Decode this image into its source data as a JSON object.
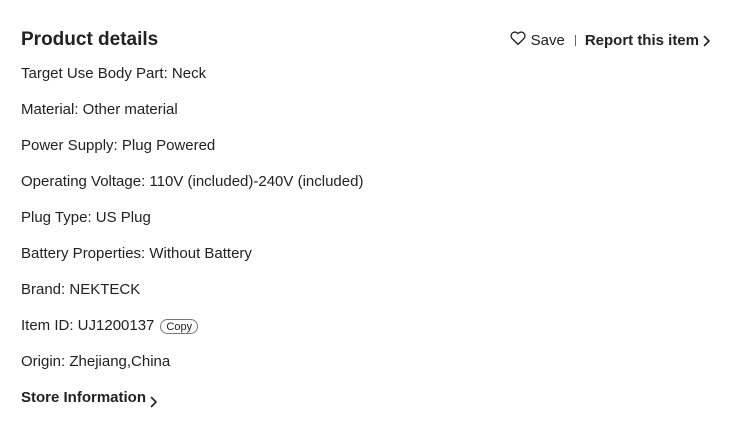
{
  "header": {
    "title": "Product details",
    "save_label": "Save",
    "report_label": "Report this item"
  },
  "details": [
    {
      "label": "Target Use Body Part: Neck"
    },
    {
      "label": "Material: Other material"
    },
    {
      "label": "Power Supply: Plug Powered"
    },
    {
      "label": "Operating Voltage: 110V (included)-240V (included)"
    },
    {
      "label": "Plug Type: US Plug"
    },
    {
      "label": "Battery Properties: Without Battery"
    },
    {
      "label": "Brand: NEKTECK"
    },
    {
      "label": "Item ID: UJ1200137",
      "copy_label": "Copy"
    },
    {
      "label": "Origin: Zhejiang,China"
    }
  ],
  "store": {
    "label": "Store Information"
  },
  "icons": {
    "save": "heart-icon",
    "report_chevron": "chevron-right-icon",
    "store_chevron": "chevron-right-icon"
  },
  "colors": {
    "text": "#222222",
    "background": "#ffffff",
    "separator": "#666666"
  }
}
